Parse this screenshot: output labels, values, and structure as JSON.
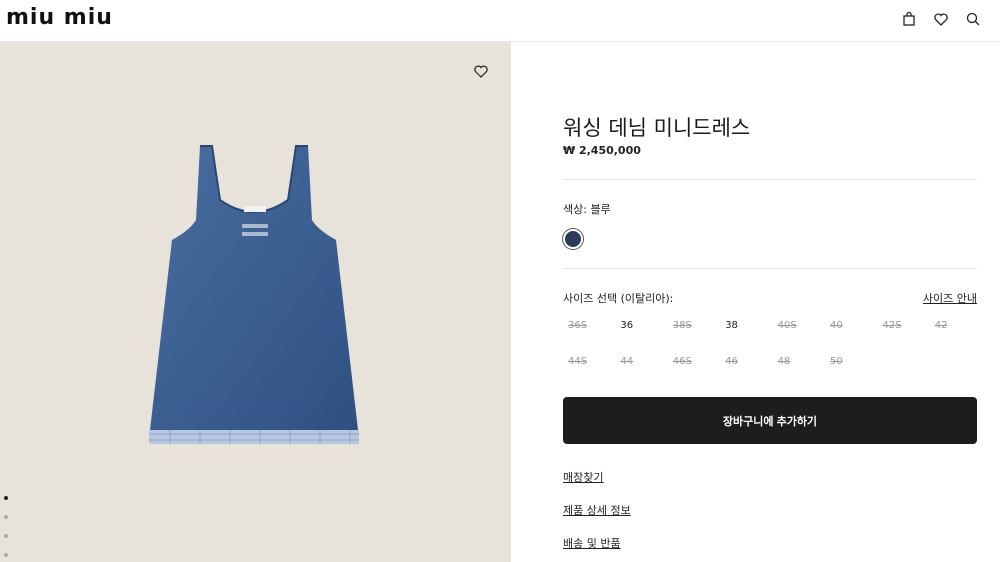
{
  "header": {
    "logo": "miu miu",
    "icons": [
      "bag-icon",
      "heart-icon",
      "search-icon"
    ]
  },
  "product": {
    "title": "워싱 데님 미니드레스",
    "price": "₩ 2,450,000",
    "color_label": "색상:  블루",
    "swatch_color": "#2b3b5a",
    "size_label": "사이즈 선택 (이탈리아):",
    "size_guide": "사이즈 안내",
    "sizes": [
      {
        "label": "36S",
        "available": false
      },
      {
        "label": "36",
        "available": true
      },
      {
        "label": "38S",
        "available": false
      },
      {
        "label": "38",
        "available": true
      },
      {
        "label": "40S",
        "available": false
      },
      {
        "label": "40",
        "available": false
      },
      {
        "label": "42S",
        "available": false
      },
      {
        "label": "42",
        "available": false
      },
      {
        "label": "44S",
        "available": false
      },
      {
        "label": "44",
        "available": false
      },
      {
        "label": "46S",
        "available": false
      },
      {
        "label": "46",
        "available": false
      },
      {
        "label": "48",
        "available": false
      },
      {
        "label": "50",
        "available": false
      }
    ],
    "add_to_cart": "장바구니에 추가하기",
    "links": {
      "store_finder": "매장찾기",
      "product_details": "제품 상세 정보",
      "shipping_returns": "배송 및 반품"
    }
  },
  "gallery": {
    "background": "#e7e2da",
    "active_slide": 1,
    "slides": 4
  }
}
